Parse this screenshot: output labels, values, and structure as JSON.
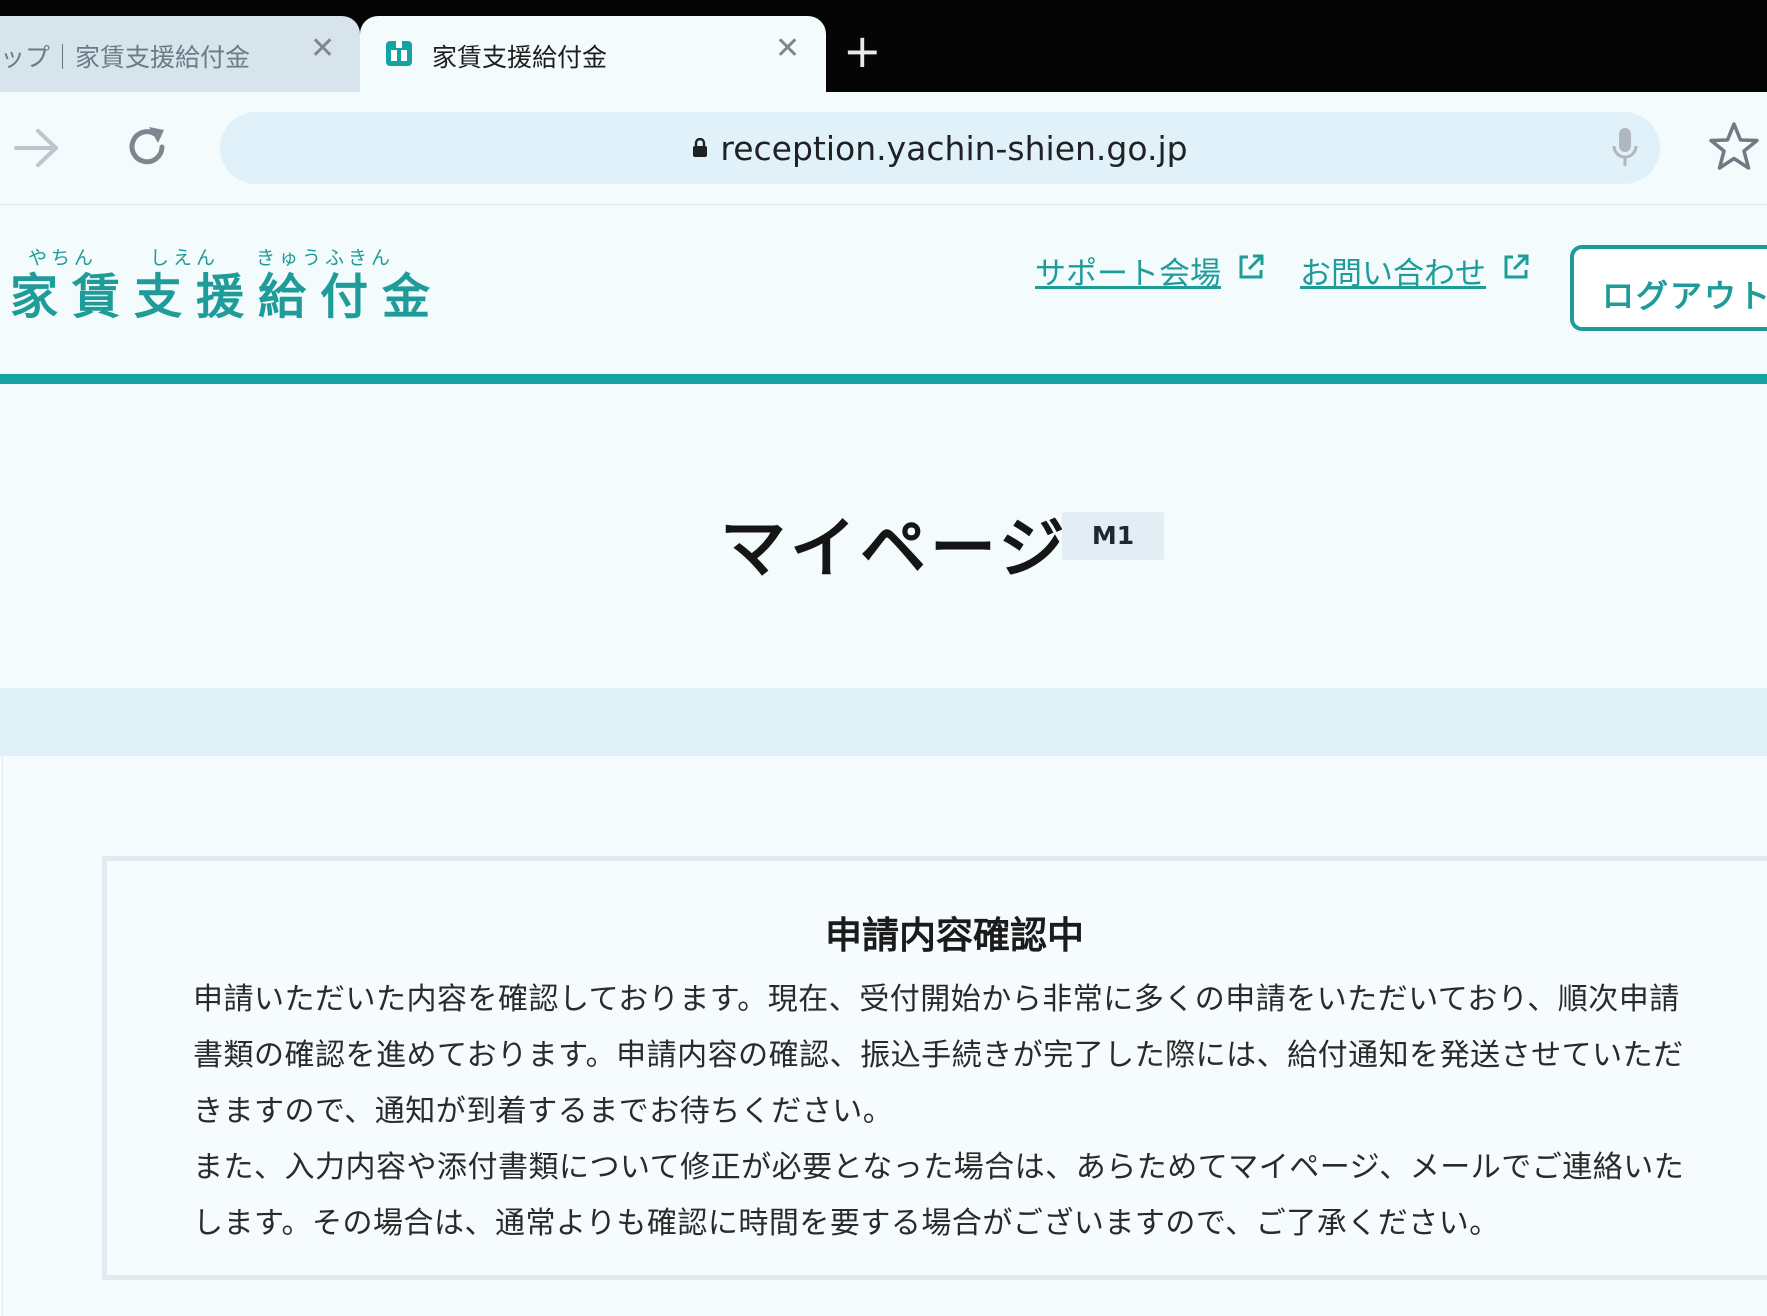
{
  "browser": {
    "tabs": [
      {
        "title": "ップ｜家賃支援給付金",
        "active": false
      },
      {
        "title": "家賃支援給付金",
        "active": true
      }
    ],
    "new_tab_glyph": "+",
    "close_glyph": "✕",
    "url": "reception.yachin-shien.go.jp",
    "icons": [
      "forward-arrow-icon",
      "reload-icon",
      "lock-icon",
      "microphone-icon",
      "star-icon",
      "favicon"
    ]
  },
  "header": {
    "logo_ruby": [
      "やちん",
      "しえん",
      "きゅうふきん"
    ],
    "logo_text": "家賃支援給付金",
    "links": [
      {
        "label": "サポート会場",
        "external": true
      },
      {
        "label": "お問い合わせ",
        "external": true
      }
    ],
    "logout_label": "ログアウト"
  },
  "page": {
    "title": "マイページ",
    "code": "M1"
  },
  "notice": {
    "title": "申請内容確認中",
    "paragraph1": "申請いただいた内容を確認しております。現在、受付開始から非常に多くの申請をいただいており、順次申請書類の確認を進めております。申請内容の確認、振込手続きが完了した際には、給付通知を発送させていただきますので、通知が到着するまでお待ちください。",
    "paragraph2": "また、入力内容や添付書類について修正が必要となった場合は、あらためてマイページ、メールでご連絡いたします。その場合は、通常よりも確認に時間を要する場合がございますので、ご了承ください。"
  },
  "colors": {
    "accent": "#1f9c9a",
    "rule": "#13a3a3",
    "tabstrip": "#050505",
    "page_bg": "#f3fbfd"
  }
}
